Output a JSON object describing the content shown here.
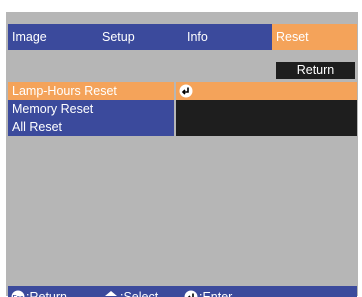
{
  "tabs": [
    {
      "label": "Image",
      "active": false
    },
    {
      "label": "Setup",
      "active": false
    },
    {
      "label": "Info",
      "active": false
    },
    {
      "label": "Reset",
      "active": true
    }
  ],
  "return_button": "Return",
  "menu": {
    "items": [
      {
        "label": "Lamp-Hours Reset",
        "selected": true
      },
      {
        "label": "Memory Reset",
        "selected": false
      },
      {
        "label": "All Reset",
        "selected": false
      }
    ]
  },
  "value_panel": {
    "row0_icon": "enter-icon"
  },
  "footer": {
    "esc_label": ":Return",
    "select_label": ":Select",
    "enter_label": ":Enter",
    "esc_icon": "esc-icon",
    "select_icon": "up-down-arrow-icon",
    "enter_icon": "enter-icon"
  },
  "colors": {
    "bar": "#3b4a9c",
    "highlight": "#f4a35a",
    "panel_dark": "#1e1e1e",
    "background": "#b6b6b6"
  }
}
